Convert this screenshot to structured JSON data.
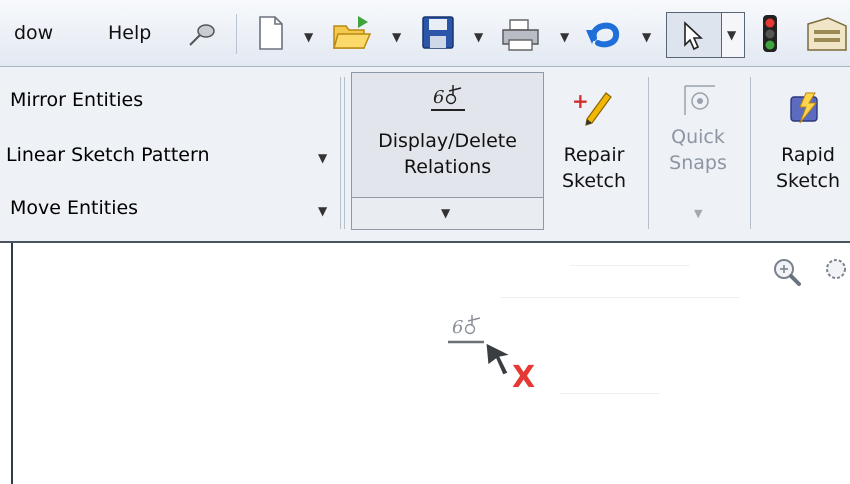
{
  "menubar": {
    "items": [
      {
        "label": "dow"
      },
      {
        "label": "Help"
      }
    ]
  },
  "ribbon": {
    "sketch_tools": [
      {
        "label": "Mirror Entities"
      },
      {
        "label": "Linear Sketch Pattern"
      },
      {
        "label": "Move Entities"
      }
    ],
    "display_delete": {
      "label_line1": "Display/Delete",
      "label_line2": "Relations"
    },
    "repair_sketch": {
      "label_line1": "Repair",
      "label_line2": "Sketch"
    },
    "quick_snaps": {
      "label_line1": "Quick",
      "label_line2": "Snaps"
    },
    "rapid_sketch": {
      "label_line1": "Rapid",
      "label_line2": "Sketch"
    }
  },
  "canvas": {
    "cursor_mark": "X"
  },
  "colors": {
    "accent_red": "#e53935",
    "repair_red": "#d32f2f",
    "pencil_yellow": "#f2b705",
    "save_blue": "#2a55a8",
    "undo_blue": "#1e6fd9"
  }
}
